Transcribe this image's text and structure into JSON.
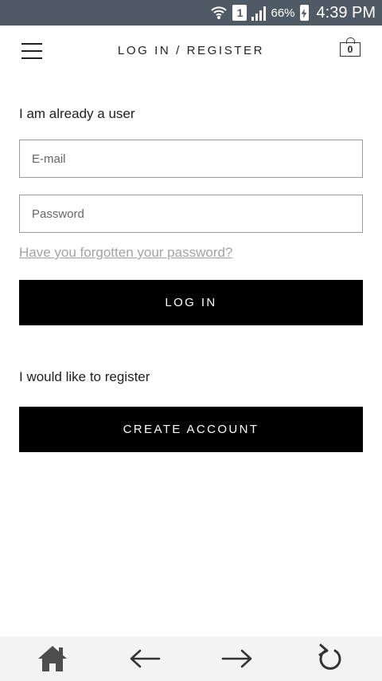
{
  "status_bar": {
    "battery_percent": "66%",
    "time": "4:39 PM",
    "sim_label": "1",
    "icons": [
      "wifi-icon",
      "sim-icon",
      "signal-icon",
      "battery-icon"
    ]
  },
  "header": {
    "title": "LOG IN / REGISTER",
    "cart_count": "0"
  },
  "login": {
    "heading": "I am already a user",
    "email_placeholder": "E-mail",
    "password_placeholder": "Password",
    "forgot_link": "Have you forgotten your password?",
    "login_button": "LOG IN"
  },
  "register": {
    "heading": "I would like to register",
    "create_button": "CREATE ACCOUNT"
  },
  "browser_nav": {
    "icons": [
      "home-icon",
      "back-arrow-icon",
      "forward-arrow-icon",
      "refresh-icon"
    ]
  },
  "colors": {
    "status_bar_bg": "#505a64",
    "button_bg": "#000000",
    "link": "#a3a3a3",
    "bottom_bar_bg": "#f3f3f3"
  }
}
